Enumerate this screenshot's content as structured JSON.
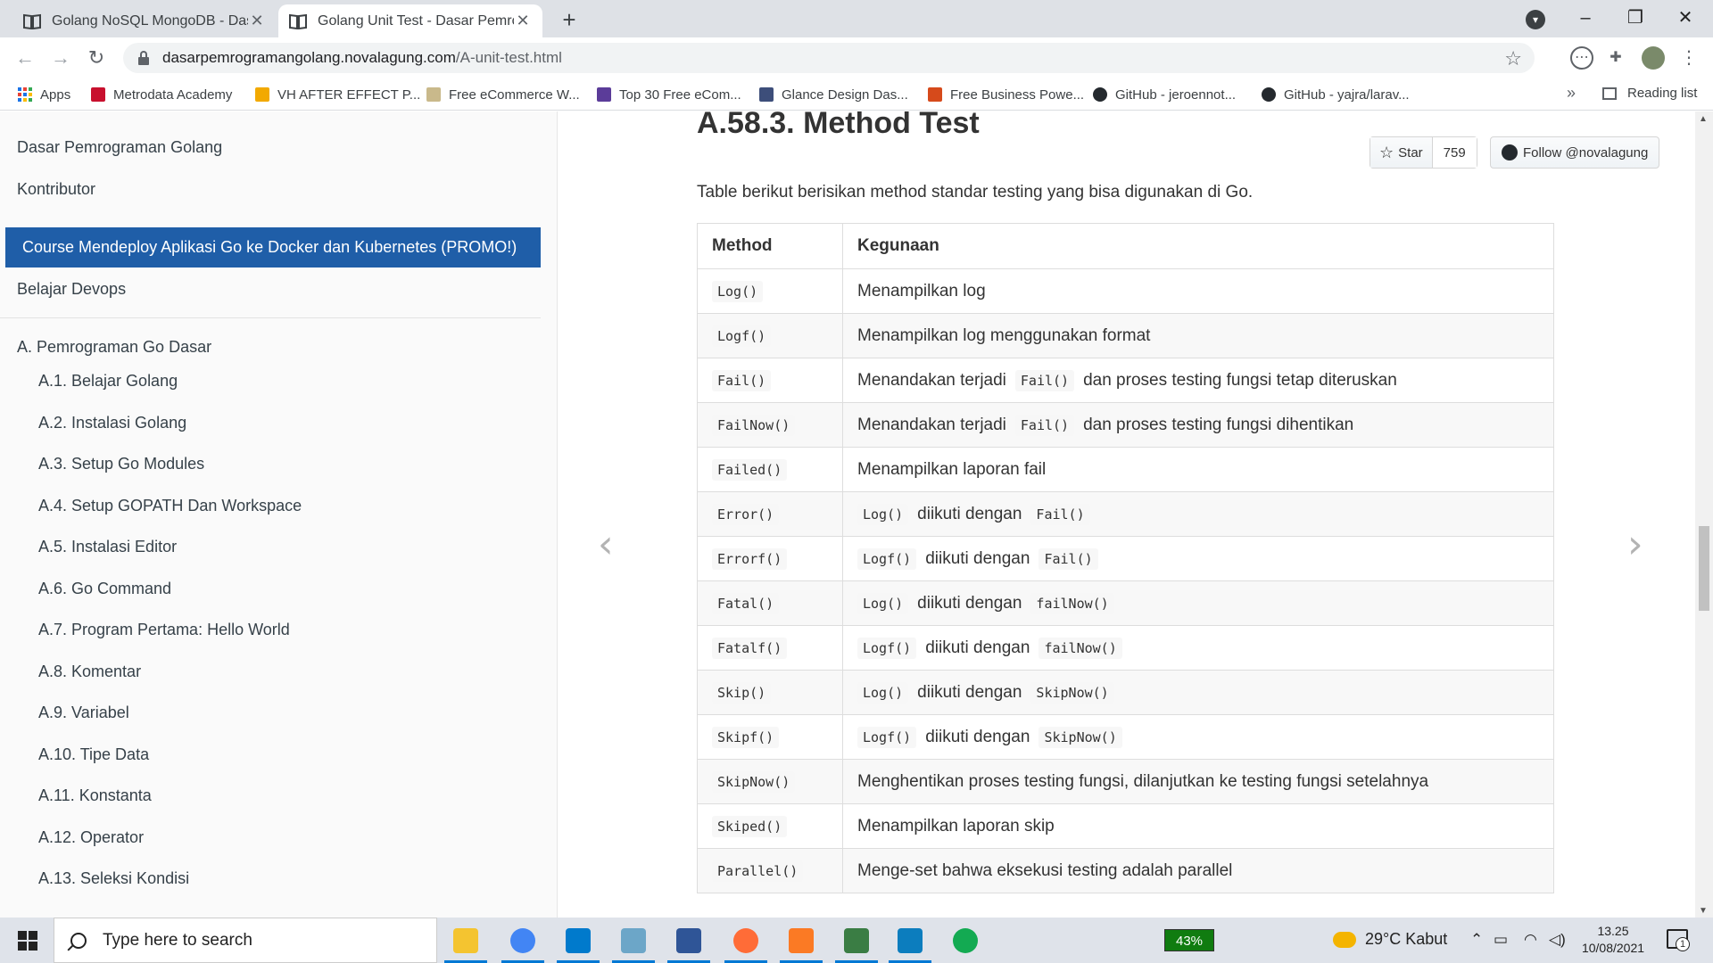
{
  "browser": {
    "tabs": [
      {
        "title": "Golang NoSQL MongoDB - Dasar",
        "active": false
      },
      {
        "title": "Golang Unit Test - Dasar Pemrog",
        "active": true
      }
    ],
    "url_host": "dasarpemrogramangolang.novalagung.com",
    "url_path": "/A-unit-test.html",
    "bookmarks": [
      {
        "label": "Apps",
        "icon": "apps-grid-icon"
      },
      {
        "label": "Metrodata Academy",
        "icon": "metrodata-icon",
        "color": "#c8102e"
      },
      {
        "label": "VH AFTER EFFECT P...",
        "icon": "vh-icon",
        "color": "#f2a900"
      },
      {
        "label": "Free eCommerce W...",
        "icon": "ecommerce-icon",
        "color": "#c9b98b"
      },
      {
        "label": "Top 30 Free eCom...",
        "icon": "colorlib-icon",
        "color": "#5b3c99"
      },
      {
        "label": "Glance Design Das...",
        "icon": "w3-icon",
        "color": "#3d4e7a"
      },
      {
        "label": "Free Business Powe...",
        "icon": "p-icon",
        "color": "#d64a1b"
      },
      {
        "label": "GitHub - jeroennot...",
        "icon": "github-icon",
        "color": "#24292e"
      },
      {
        "label": "GitHub - yajra/larav...",
        "icon": "github-icon",
        "color": "#24292e"
      }
    ],
    "overflow_label": "»",
    "reading_list": "Reading list"
  },
  "sidebar": {
    "top_links": [
      "Dasar Pemrograman Golang",
      "Kontributor"
    ],
    "promo": "Course Mendeploy Aplikasi Go ke Docker dan Kubernetes (PROMO!)",
    "devops": "Belajar Devops",
    "section": "A. Pemrograman Go Dasar",
    "chapters": [
      "A.1. Belajar Golang",
      "A.2. Instalasi Golang",
      "A.3. Setup Go Modules",
      "A.4. Setup GOPATH Dan Workspace",
      "A.5. Instalasi Editor",
      "A.6. Go Command",
      "A.7. Program Pertama: Hello World",
      "A.8. Komentar",
      "A.9. Variabel",
      "A.10. Tipe Data",
      "A.11. Konstanta",
      "A.12. Operator",
      "A.13. Seleksi Kondisi"
    ]
  },
  "content": {
    "title": "A.58.3. Method Test",
    "intro": "Table berikut berisikan method standar testing yang bisa digunakan di Go.",
    "github": {
      "star_label": "Star",
      "star_count": "759",
      "follow_label": "Follow @novalagung"
    },
    "table": {
      "headers": [
        "Method",
        "Kegunaan"
      ],
      "rows": [
        {
          "method": "Log()",
          "desc": [
            {
              "t": "Menampilkan log"
            }
          ]
        },
        {
          "method": "Logf()",
          "desc": [
            {
              "t": "Menampilkan log menggunakan format"
            }
          ]
        },
        {
          "method": "Fail()",
          "desc": [
            {
              "t": "Menandakan terjadi"
            },
            {
              "c": "Fail()"
            },
            {
              "t": "dan proses testing fungsi tetap diteruskan"
            }
          ]
        },
        {
          "method": "FailNow()",
          "desc": [
            {
              "t": "Menandakan terjadi"
            },
            {
              "c": "Fail()"
            },
            {
              "t": "dan proses testing fungsi dihentikan"
            }
          ]
        },
        {
          "method": "Failed()",
          "desc": [
            {
              "t": "Menampilkan laporan fail"
            }
          ]
        },
        {
          "method": "Error()",
          "desc": [
            {
              "c": "Log()"
            },
            {
              "t": "diikuti dengan"
            },
            {
              "c": "Fail()"
            }
          ]
        },
        {
          "method": "Errorf()",
          "desc": [
            {
              "c": "Logf()"
            },
            {
              "t": "diikuti dengan"
            },
            {
              "c": "Fail()"
            }
          ]
        },
        {
          "method": "Fatal()",
          "desc": [
            {
              "c": "Log()"
            },
            {
              "t": "diikuti dengan"
            },
            {
              "c": "failNow()"
            }
          ]
        },
        {
          "method": "Fatalf()",
          "desc": [
            {
              "c": "Logf()"
            },
            {
              "t": "diikuti dengan"
            },
            {
              "c": "failNow()"
            }
          ]
        },
        {
          "method": "Skip()",
          "desc": [
            {
              "c": "Log()"
            },
            {
              "t": "diikuti dengan"
            },
            {
              "c": "SkipNow()"
            }
          ]
        },
        {
          "method": "Skipf()",
          "desc": [
            {
              "c": "Logf()"
            },
            {
              "t": "diikuti dengan"
            },
            {
              "c": "SkipNow()"
            }
          ]
        },
        {
          "method": "SkipNow()",
          "desc": [
            {
              "t": "Menghentikan proses testing fungsi, dilanjutkan ke testing fungsi setelahnya"
            }
          ]
        },
        {
          "method": "Skiped()",
          "desc": [
            {
              "t": "Menampilkan laporan skip"
            }
          ]
        },
        {
          "method": "Parallel()",
          "desc": [
            {
              "t": "Menge-set bahwa eksekusi testing adalah parallel"
            }
          ]
        }
      ]
    }
  },
  "taskbar": {
    "search_placeholder": "Type here to search",
    "apps": [
      {
        "name": "file-explorer",
        "color": "#f4c430"
      },
      {
        "name": "chrome",
        "color": "#4285f4"
      },
      {
        "name": "vscode",
        "color": "#007acc"
      },
      {
        "name": "notepad",
        "color": "#6ca6c8"
      },
      {
        "name": "network-app",
        "color": "#2f5597"
      },
      {
        "name": "postman",
        "color": "#ff6c37"
      },
      {
        "name": "xampp",
        "color": "#fb7a24"
      },
      {
        "name": "task-manager",
        "color": "#3a7d44"
      },
      {
        "name": "goland",
        "color": "#0c7dbe"
      },
      {
        "name": "mongodb-compass",
        "color": "#13aa52"
      }
    ],
    "battery": "43%",
    "weather": "29°C  Kabut",
    "time": "13.25",
    "date": "10/08/2021",
    "notification_count": "1"
  }
}
